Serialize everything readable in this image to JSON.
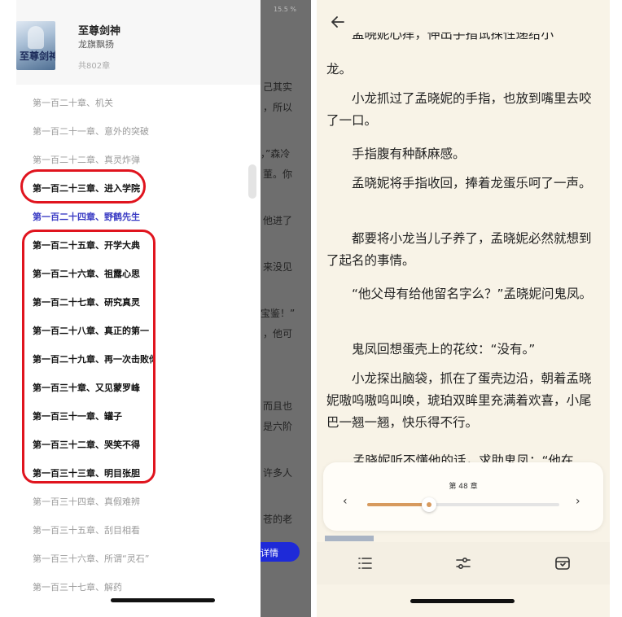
{
  "book": {
    "cover_title": "至尊剑神",
    "title": "至尊剑神",
    "author": "龙旗飘扬",
    "chapter_count": "共802章"
  },
  "chapters": [
    {
      "label": "第一百二十章、机关",
      "state": "muted"
    },
    {
      "label": "第一百二十一章、意外的突破",
      "state": "muted"
    },
    {
      "label": "第一百二十二章、真灵炸弹",
      "state": "muted"
    },
    {
      "label": "第一百二十三章、进入学院",
      "state": "bold"
    },
    {
      "label": "第一百二十四章、野鹤先生",
      "state": "current"
    },
    {
      "label": "第一百二十五章、开学大典",
      "state": "bold"
    },
    {
      "label": "第一百二十六章、祖露心思",
      "state": "bold"
    },
    {
      "label": "第一百二十七章、研究真灵",
      "state": "bold"
    },
    {
      "label": "第一百二十八章、真正的第一",
      "state": "bold"
    },
    {
      "label": "第一百二十九章、再一次击败你",
      "state": "bold"
    },
    {
      "label": "第一百三十章、又见蒙罗峰",
      "state": "bold"
    },
    {
      "label": "第一百三十一章、罐子",
      "state": "bold"
    },
    {
      "label": "第一百三十二章、哭笑不得",
      "state": "bold"
    },
    {
      "label": "第一百三十三章、明目张胆",
      "state": "bold"
    },
    {
      "label": "第一百三十四章、真假难辨",
      "state": "muted"
    },
    {
      "label": "第一百三十五章、刮目相看",
      "state": "muted"
    },
    {
      "label": "第一百三十六章、所谓“灵石”",
      "state": "muted"
    },
    {
      "label": "第一百三十七章、解药",
      "state": "muted"
    }
  ],
  "dimmed_page": {
    "percent": "15.5 %",
    "fragments": [
      "己其实",
      "，所以",
      "，”森冷",
      "董。你",
      "他进了",
      "来没见",
      "宝鉴！”",
      "，他可",
      "而且也",
      "是六阶",
      "许多人",
      "苍的老"
    ],
    "detail_button": "详情"
  },
  "reader": {
    "top_cut_text": "孟晓妮心痒，伸出手指试探性递给小",
    "paragraphs": [
      "龙。",
      "小龙抓过了孟晓妮的手指，也放到嘴里去咬了一口。",
      "手指腹有种酥麻感。",
      "孟晓妮将手指收回，捧着龙蛋乐呵了一声。",
      "都要将小龙当儿子养了，孟晓妮必然就想到了起名的事情。",
      "“他父母有给他留名字么？”孟晓妮问鬼凤。",
      "鬼凤回想蛋壳上的花纹：“没有。”",
      "小龙探出脑袋，抓在了蛋壳边沿，朝着孟晓妮嗷呜嗷呜叫唤，琥珀双眸里充满着欢喜，小尾巴一翘一翘，快乐得不行。"
    ],
    "bottom_cut_text": "孟晓妮听不懂他的话，求助鬼凤：“他在"
  },
  "progress": {
    "chapter_label": "第 48 章",
    "prev": "‹",
    "next": "›",
    "fraction": 0.32
  },
  "toolbar": {
    "items": [
      "catalog-icon",
      "settings-icon",
      "bookmark-icon"
    ]
  },
  "colors": {
    "accent": "#d79a5e",
    "current_chapter": "#3a3bc4",
    "annotation": "#e0141e",
    "reader_bg": "#f8f3e7"
  }
}
